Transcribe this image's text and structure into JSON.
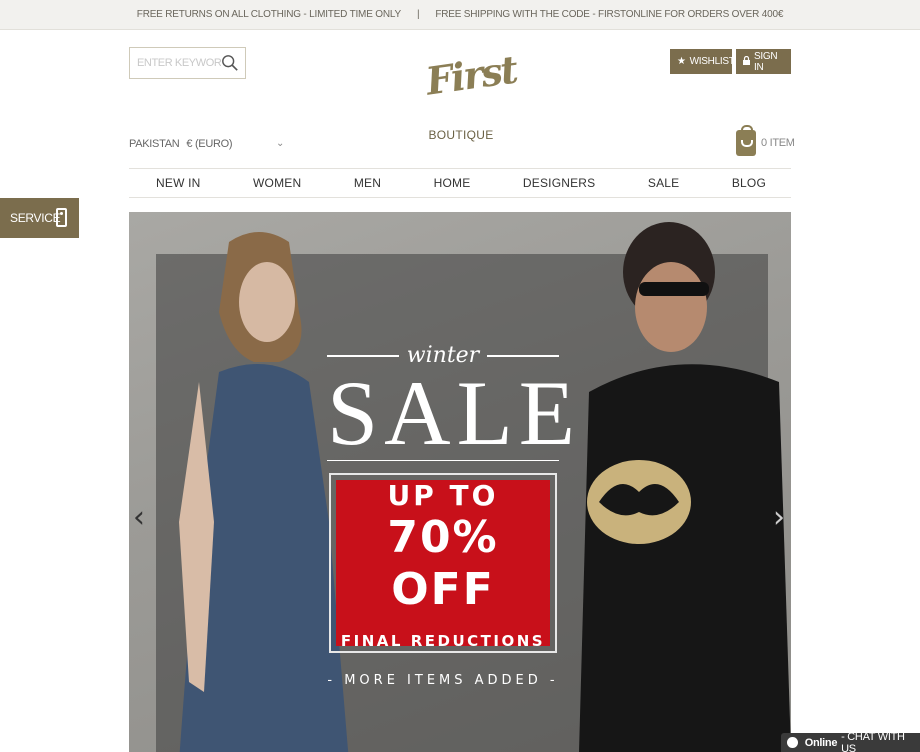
{
  "topbar": {
    "returns": "FREE RETURNS ON ALL CLOTHING - LIMITED TIME ONLY",
    "separator": "|",
    "shipping": "FREE SHIPPING WITH THE CODE - FIRSTONLINE FOR ORDERS OVER 400€"
  },
  "search": {
    "placeholder": "ENTER KEYWORD",
    "icon": "search-icon"
  },
  "logo": {
    "script": "First",
    "word": "BOUTIQUE"
  },
  "account": {
    "wishlist": "WISHLIST",
    "signin": "SIGN IN"
  },
  "locale": {
    "country": "PAKISTAN",
    "currency": "€ (EURO)"
  },
  "cart": {
    "count_label": "0 ITEM"
  },
  "nav": {
    "items": [
      {
        "label": "NEW IN"
      },
      {
        "label": "WOMEN"
      },
      {
        "label": "MEN"
      },
      {
        "label": "HOME"
      },
      {
        "label": "DESIGNERS"
      },
      {
        "label": "SALE"
      },
      {
        "label": "BLOG"
      }
    ]
  },
  "service": {
    "label": "SERVICE"
  },
  "hero": {
    "winter": "winter",
    "sale": "SALE",
    "upto": "UP TO",
    "percent": "70% OFF",
    "final": "FINAL REDUCTIONS",
    "more": "- MORE ITEMS ADDED -",
    "prev": "‹",
    "next": "›"
  },
  "chat": {
    "status": "Online",
    "label": "- CHAT WITH US"
  },
  "colors": {
    "accent": "#7b6d4d",
    "sale_red": "#c8101a",
    "chat_bg": "#3a3a3a"
  }
}
